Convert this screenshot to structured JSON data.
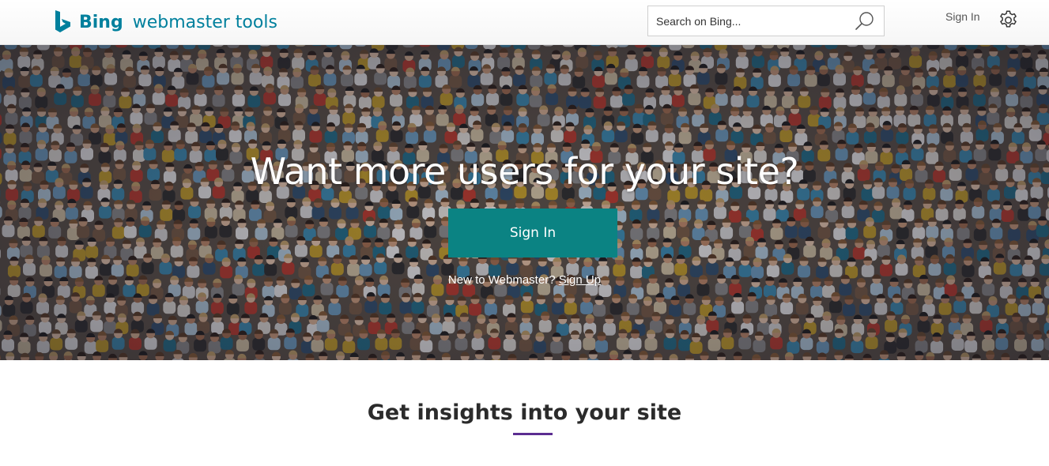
{
  "header": {
    "brand_name": "Bing",
    "product_name": "webmaster tools",
    "search": {
      "placeholder": "Search on Bing...",
      "value": ""
    },
    "search_icon": "search-icon",
    "sign_in_label": "Sign In",
    "settings_icon": "gear-icon"
  },
  "hero": {
    "title": "Want more users for your site?",
    "sign_in_button_label": "Sign In",
    "new_user_text": "New to Webmaster?",
    "sign_up_label": "Sign Up",
    "background": "crowd-photo"
  },
  "insights": {
    "title": "Get insights into your site"
  },
  "colors": {
    "brand_teal": "#00809d",
    "button_teal": "#0b8383",
    "accent_purple": "#5c2d91"
  }
}
